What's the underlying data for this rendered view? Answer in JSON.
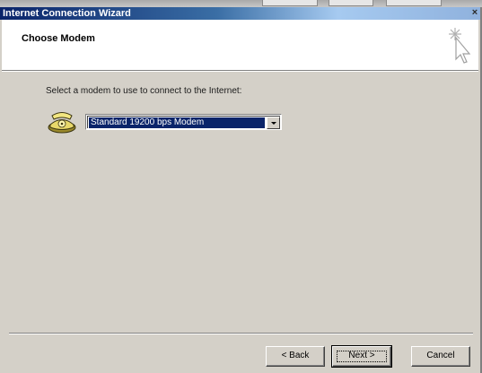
{
  "window": {
    "title": "Internet Connection Wizard",
    "close_glyph": "×"
  },
  "header": {
    "title": "Choose Modem",
    "icon": "wizard-sparkle-cursor-icon"
  },
  "body": {
    "prompt": "Select a modem to use to connect to the Internet:",
    "modem_icon": "telephone-modem-icon",
    "modem_select": {
      "selected": "Standard 19200 bps Modem"
    }
  },
  "buttons": {
    "back": "< Back",
    "next": "Next >",
    "cancel": "Cancel"
  },
  "colors": {
    "titlebar_start": "#0a246a",
    "titlebar_end": "#a6caf0",
    "dialog_face": "#d4d0c8",
    "selection": "#0a246a"
  }
}
